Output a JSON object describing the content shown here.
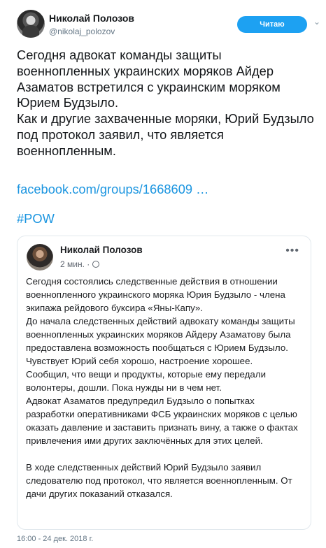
{
  "tweet": {
    "author_name": "Николай Полозов",
    "author_handle": "@nikolaj_polozov",
    "follow_label": "Читаю",
    "text_lines": [
      "Сегодня адвокат команды защиты военнопленных украинских моряков Айдер Азаматов встретился с украинским моряком Юрием Будзыло.",
      "Как и другие захваченные моряки, Юрий Будзыло под протокол заявил, что является военнопленным."
    ],
    "link": "facebook.com/groups/1668609 …",
    "hashtag": "#POW",
    "timestamp": "16:00 - 24 дек. 2018 г."
  },
  "embed": {
    "author_name": "Николай Полозов",
    "time": "2 мин. ·",
    "paragraphs": [
      "Сегодня состоялись следственные действия в отношении военнопленного украинского моряка Юрия Будзыло - члена экипажа рейдового буксира «Яны-Капу».",
      "До начала следственных действий адвокату команды защиты военнопленных украинских моряков Айдеру Азаматову была предоставлена возможность пообщаться с Юрием Будзыло.",
      "Чувствует Юрий себя хорошо, настроение хорошее.",
      "Сообщил, что вещи и продукты, которые ему передали волонтеры, дошли. Пока нужды ни в чем нет.",
      "Адвокат Азаматов предупредил Будзыло о попытках разработки оперативниками ФСБ украинских моряков с целью оказать давление и заставить признать вину, а также о фактах привлечения ими других заключённых для этих целей.",
      "",
      "В ходе следственных действий Юрий Будзыло заявил следователю под протокол, что является военнопленным. От дачи других показаний отказался."
    ]
  },
  "colors": {
    "accent": "#1da1f2",
    "link": "#1b95e0"
  }
}
